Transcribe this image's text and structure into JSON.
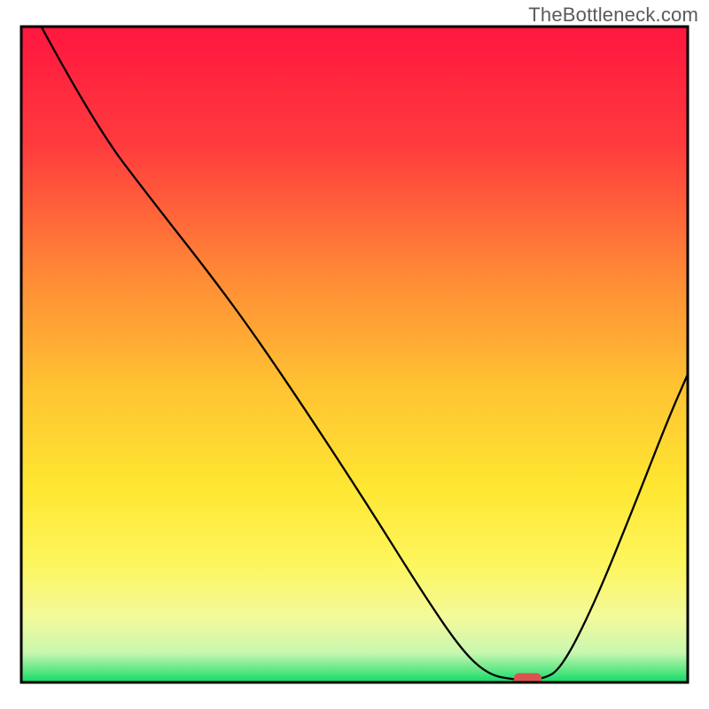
{
  "watermark": "TheBottleneck.com",
  "chart_data": {
    "type": "line",
    "title": "",
    "xlabel": "",
    "ylabel": "",
    "xlim": [
      0,
      100
    ],
    "ylim": [
      0,
      100
    ],
    "grid": false,
    "legend": false,
    "background_gradient_stops": [
      {
        "offset": 0.0,
        "color": "#ff163f"
      },
      {
        "offset": 0.18,
        "color": "#ff3b3e"
      },
      {
        "offset": 0.38,
        "color": "#ff8a36"
      },
      {
        "offset": 0.55,
        "color": "#ffc332"
      },
      {
        "offset": 0.7,
        "color": "#ffe631"
      },
      {
        "offset": 0.82,
        "color": "#fdf65e"
      },
      {
        "offset": 0.9,
        "color": "#f3fa9a"
      },
      {
        "offset": 0.955,
        "color": "#c9f7b0"
      },
      {
        "offset": 0.985,
        "color": "#4fe57f"
      },
      {
        "offset": 1.0,
        "color": "#10d869"
      }
    ],
    "series": [
      {
        "name": "bottleneck-curve",
        "stroke": "#000000",
        "stroke_width": 2.3,
        "points": [
          {
            "x": 3.0,
            "y": 100.0
          },
          {
            "x": 11.0,
            "y": 85.0
          },
          {
            "x": 20.0,
            "y": 73.0
          },
          {
            "x": 28.5,
            "y": 62.0
          },
          {
            "x": 35.0,
            "y": 53.0
          },
          {
            "x": 43.0,
            "y": 41.0
          },
          {
            "x": 52.0,
            "y": 27.0
          },
          {
            "x": 60.0,
            "y": 14.0
          },
          {
            "x": 66.0,
            "y": 5.0
          },
          {
            "x": 70.0,
            "y": 1.2
          },
          {
            "x": 74.0,
            "y": 0.4
          },
          {
            "x": 78.0,
            "y": 0.4
          },
          {
            "x": 81.0,
            "y": 2.0
          },
          {
            "x": 86.0,
            "y": 12.0
          },
          {
            "x": 92.0,
            "y": 27.0
          },
          {
            "x": 97.0,
            "y": 40.0
          },
          {
            "x": 100.0,
            "y": 47.0
          }
        ]
      }
    ],
    "marker": {
      "name": "optimal-marker",
      "x": 76.0,
      "y": 0.6,
      "width": 4.2,
      "height": 1.6,
      "fill": "#d9534f",
      "rx": 6
    },
    "frame": {
      "stroke": "#000000",
      "stroke_width": 3
    }
  }
}
